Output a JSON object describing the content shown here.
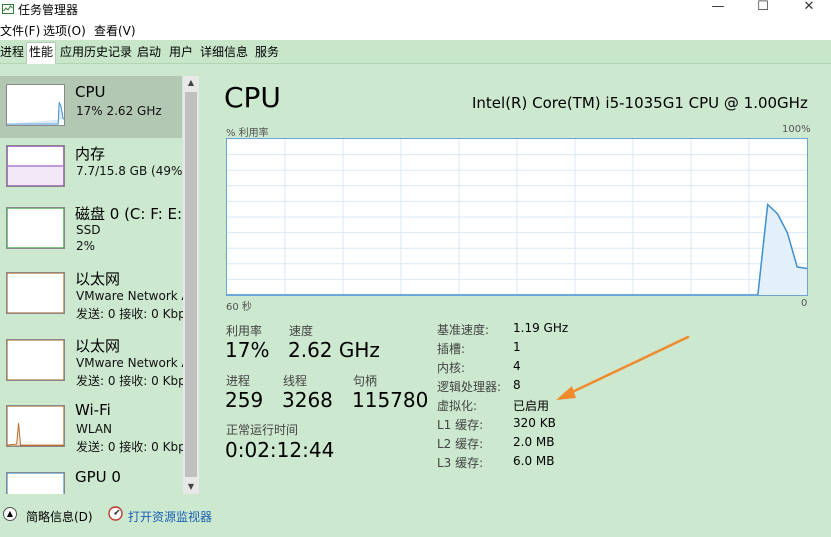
{
  "window": {
    "title": "任务管理器",
    "min_glyph": "—",
    "max_glyph": "☐",
    "close_glyph": "✕"
  },
  "menu": {
    "items": [
      "文件(F)",
      "选项(O)",
      "查看(V)"
    ]
  },
  "tabs": {
    "items": [
      "进程",
      "性能",
      "应用历史记录",
      "启动",
      "用户",
      "详细信息",
      "服务"
    ],
    "active": "性能"
  },
  "sidebar": {
    "items": [
      {
        "title": "CPU",
        "line1": "17%  2.62 GHz",
        "line2": "",
        "color": "#3c8fd0",
        "selected": true
      },
      {
        "title": "内存",
        "line1": "7.7/15.8 GB (49%)",
        "line2": "",
        "color": "#8e44ad",
        "selected": false
      },
      {
        "title": "磁盘 0 (C: F: E:",
        "line1": "SSD",
        "line2": "2%",
        "color": "#4caf50",
        "selected": false
      },
      {
        "title": "以太网",
        "line1": "VMware Network A",
        "line2": "发送: 0 接收: 0 Kbp",
        "color": "#b46a2a",
        "selected": false
      },
      {
        "title": "以太网",
        "line1": "VMware Network A",
        "line2": "发送: 0 接收: 0 Kbp",
        "color": "#b46a2a",
        "selected": false
      },
      {
        "title": "Wi-Fi",
        "line1": "WLAN",
        "line2": "发送: 0 接收: 0 Kbp",
        "color": "#b46a2a",
        "selected": false
      },
      {
        "title": "GPU 0",
        "line1": "",
        "line2": "",
        "color": "#3c8fd0",
        "selected": false
      }
    ]
  },
  "detail": {
    "title": "CPU",
    "model": "Intel(R) Core(TM) i5-1035G1 CPU @ 1.00GHz",
    "graph": {
      "y_label": "% 利用率",
      "y_max_label": "100%",
      "x_left_label": "60 秒",
      "x_right_label": "0",
      "line_color": "#3c8fd0",
      "samples": [
        0,
        0,
        0,
        0,
        0,
        0,
        0,
        0,
        0,
        0,
        0,
        0,
        0,
        0,
        0,
        0,
        0,
        0,
        0,
        0,
        0,
        0,
        0,
        0,
        0,
        0,
        0,
        0,
        0,
        0,
        0,
        0,
        0,
        0,
        0,
        0,
        0,
        0,
        0,
        0,
        0,
        0,
        0,
        0,
        0,
        0,
        0,
        0,
        0,
        0,
        0,
        0,
        0,
        0,
        0,
        58,
        52,
        40,
        18,
        17
      ]
    },
    "stats": {
      "utilization_label": "利用率",
      "utilization_value": "17%",
      "speed_label": "速度",
      "speed_value": "2.62 GHz",
      "processes_label": "进程",
      "processes_value": "259",
      "threads_label": "线程",
      "threads_value": "3268",
      "handles_label": "句柄",
      "handles_value": "115780",
      "uptime_label": "正常运行时间",
      "uptime_value": "0:02:12:44"
    },
    "specs": [
      {
        "label": "基准速度:",
        "value": "1.19 GHz"
      },
      {
        "label": "插槽:",
        "value": "1"
      },
      {
        "label": "内核:",
        "value": "4"
      },
      {
        "label": "逻辑处理器:",
        "value": "8"
      },
      {
        "label": "虚拟化:",
        "value": "已启用"
      },
      {
        "label": "L1 缓存:",
        "value": "320 KB"
      },
      {
        "label": "L2 缓存:",
        "value": "2.0 MB"
      },
      {
        "label": "L3 缓存:",
        "value": "6.0 MB"
      }
    ]
  },
  "footer": {
    "collapse_label": "简略信息(D)",
    "monitor_link": "打开资源监视器"
  },
  "annotation": {
    "arrow_color": "#f08a2c"
  }
}
